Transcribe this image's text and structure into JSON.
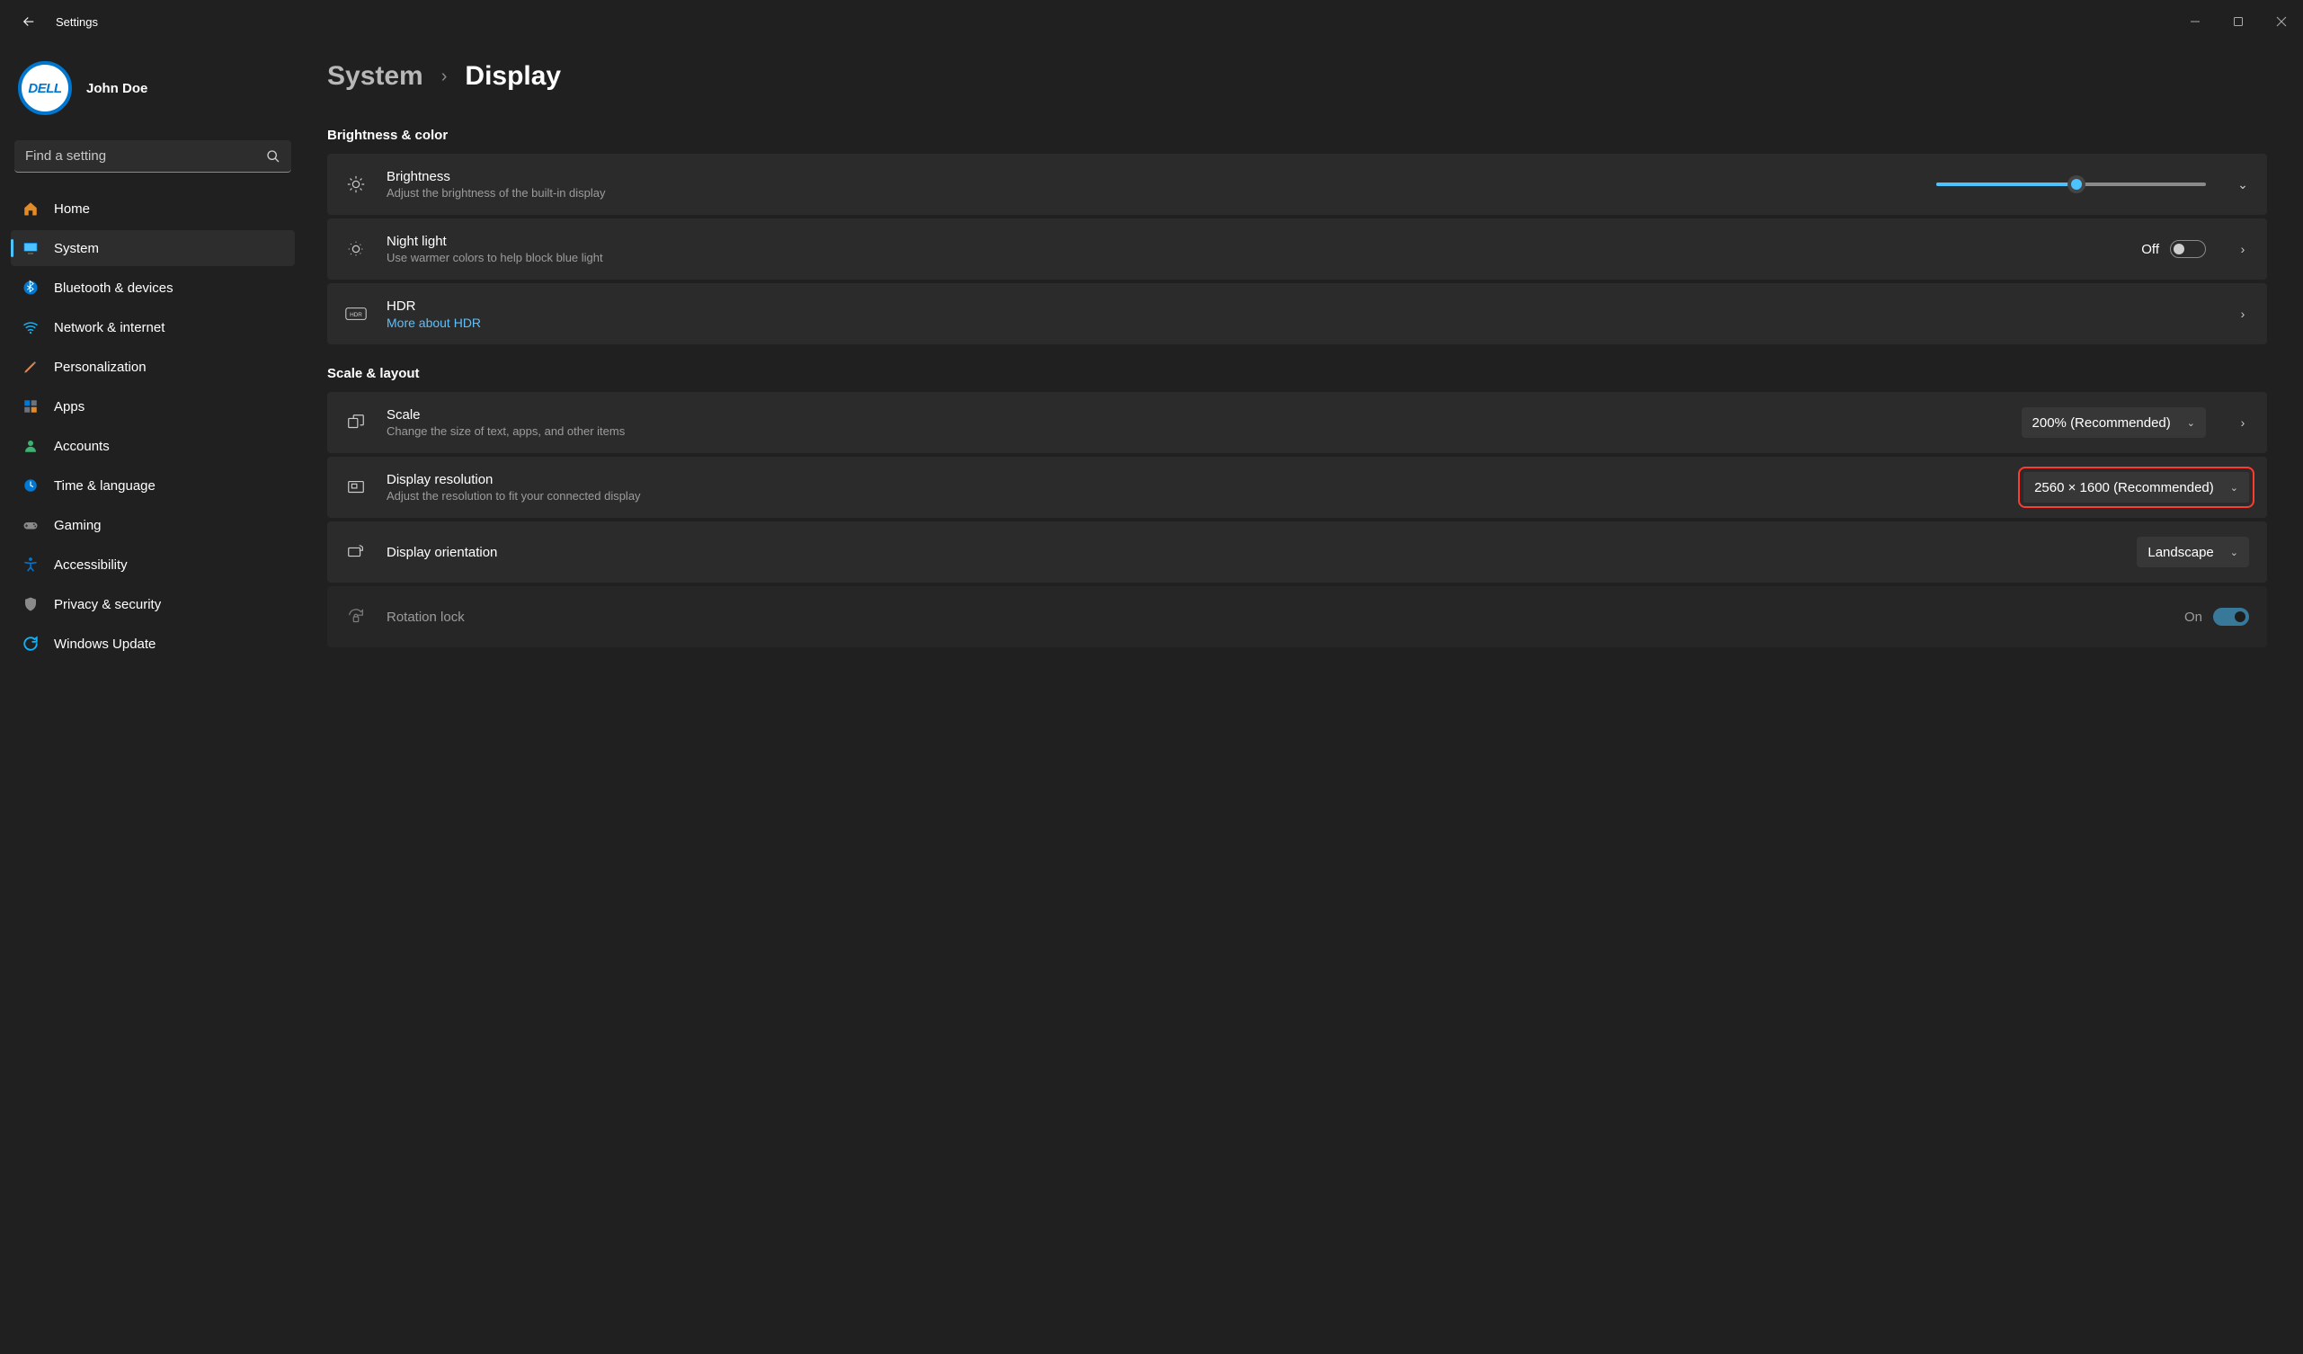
{
  "window": {
    "title": "Settings",
    "user_name": "John Doe",
    "avatar_text": "DELL"
  },
  "search": {
    "placeholder": "Find a setting"
  },
  "nav": {
    "items": [
      {
        "label": "Home"
      },
      {
        "label": "System"
      },
      {
        "label": "Bluetooth & devices"
      },
      {
        "label": "Network & internet"
      },
      {
        "label": "Personalization"
      },
      {
        "label": "Apps"
      },
      {
        "label": "Accounts"
      },
      {
        "label": "Time & language"
      },
      {
        "label": "Gaming"
      },
      {
        "label": "Accessibility"
      },
      {
        "label": "Privacy & security"
      },
      {
        "label": "Windows Update"
      }
    ]
  },
  "breadcrumb": {
    "parent": "System",
    "current": "Display"
  },
  "sections": {
    "brightness_color": "Brightness & color",
    "scale_layout": "Scale & layout"
  },
  "cards": {
    "brightness": {
      "label": "Brightness",
      "sub": "Adjust the brightness of the built-in display",
      "slider_percent": 52
    },
    "night_light": {
      "label": "Night light",
      "sub": "Use warmer colors to help block blue light",
      "state": "Off"
    },
    "hdr": {
      "label": "HDR",
      "link": "More about HDR"
    },
    "scale": {
      "label": "Scale",
      "sub": "Change the size of text, apps, and other items",
      "value": "200% (Recommended)"
    },
    "resolution": {
      "label": "Display resolution",
      "sub": "Adjust the resolution to fit your connected display",
      "value": "2560 × 1600 (Recommended)"
    },
    "orientation": {
      "label": "Display orientation",
      "value": "Landscape"
    },
    "rotation_lock": {
      "label": "Rotation lock",
      "state": "On"
    }
  }
}
